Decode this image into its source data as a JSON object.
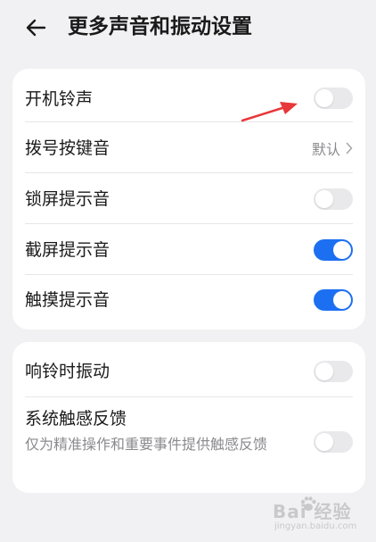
{
  "header": {
    "title": "更多声音和振动设置"
  },
  "group1": [
    {
      "label": "开机铃声",
      "control": "toggle",
      "state": "off"
    },
    {
      "label": "拨号按键音",
      "control": "value",
      "value": "默认"
    },
    {
      "label": "锁屏提示音",
      "control": "toggle",
      "state": "off"
    },
    {
      "label": "截屏提示音",
      "control": "toggle",
      "state": "on"
    },
    {
      "label": "触摸提示音",
      "control": "toggle",
      "state": "on"
    }
  ],
  "group2": [
    {
      "label": "响铃时振动",
      "control": "toggle",
      "state": "off"
    },
    {
      "label": "系统触感反馈",
      "description": "仅为精准操作和重要事件提供触感反馈",
      "control": "toggle",
      "state": "off"
    }
  ],
  "watermark": {
    "brand": "Bai 经验",
    "url": "jingyan.baidu.com"
  },
  "colors": {
    "background": "#f1f1f3",
    "card": "#ffffff",
    "toggle_on": "#1d6ff2",
    "toggle_off": "#e9e9eb",
    "annotation_arrow": "#e8373a"
  },
  "icons": {
    "back": "back-arrow-icon",
    "chevron": "chevron-right-icon"
  }
}
